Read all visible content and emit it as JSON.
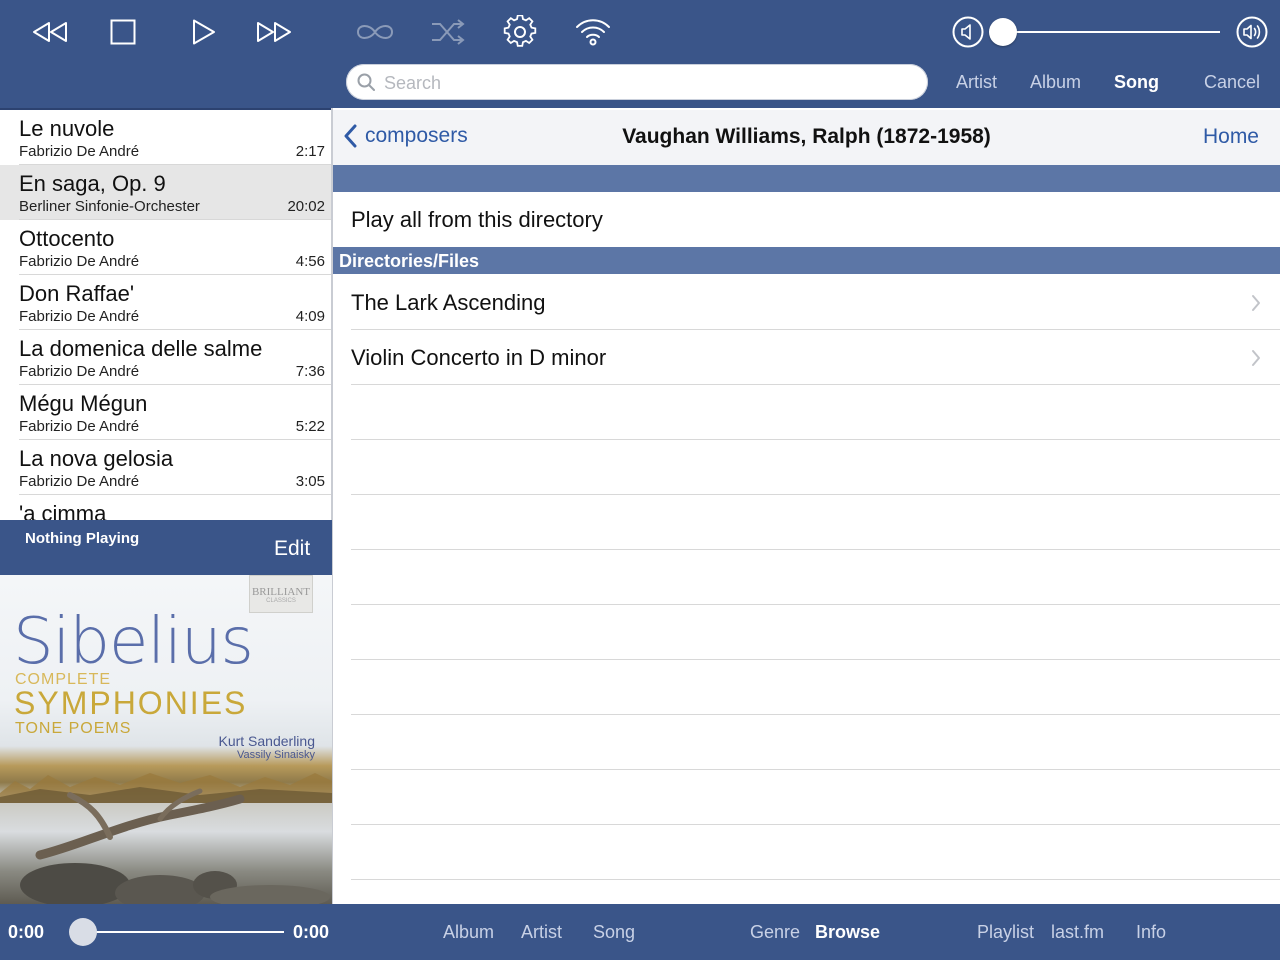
{
  "toolbar": {
    "icons": [
      "rewind-icon",
      "stop-icon",
      "play-icon",
      "fast-forward-icon",
      "repeat-icon",
      "shuffle-icon",
      "gear-icon",
      "wifi-icon",
      "volume-low-icon",
      "volume-high-icon"
    ],
    "volume_level": 0
  },
  "search": {
    "placeholder": "Search",
    "scopes": [
      "Artist",
      "Album",
      "Song"
    ],
    "active_scope": "Song",
    "cancel_label": "Cancel"
  },
  "playlist": [
    {
      "title": "Le nuvole",
      "artist": "Fabrizio De André",
      "duration": "2:17"
    },
    {
      "title": "En saga, Op. 9",
      "artist": "Berliner Sinfonie-Orchester",
      "duration": "20:02",
      "selected": true
    },
    {
      "title": "Ottocento",
      "artist": "Fabrizio De André",
      "duration": "4:56"
    },
    {
      "title": "Don Raffae'",
      "artist": "Fabrizio De André",
      "duration": "4:09"
    },
    {
      "title": "La domenica delle salme",
      "artist": "Fabrizio De André",
      "duration": "7:36"
    },
    {
      "title": "Mégu Mégun",
      "artist": "Fabrizio De André",
      "duration": "5:22"
    },
    {
      "title": "La nova gelosia",
      "artist": "Fabrizio De André",
      "duration": "3:05"
    },
    {
      "title": "'a cimma",
      "artist": "",
      "duration": ""
    }
  ],
  "now_playing": {
    "title": "Nothing Playing",
    "edit_label": "Edit"
  },
  "album_art": {
    "logo": "BRILLIANT",
    "logo_sub": "CLASSICS",
    "line_sibelius": "Sibelius",
    "line_complete": "COMPLETE",
    "line_symphonies": "SYMPHONIES",
    "line_tone_poems": "TONE POEMS",
    "conductor_1": "Kurt Sanderling",
    "conductor_2": "Vassily Sinaisky"
  },
  "browser": {
    "back_label": "composers",
    "title": "Vaughan Williams, Ralph (1872-1958)",
    "home_label": "Home",
    "play_all_label": "Play all from this directory",
    "section_header": "Directories/Files",
    "items": [
      "The Lark Ascending",
      "Violin Concerto in D minor"
    ]
  },
  "bottom": {
    "time_current": "0:00",
    "time_total": "0:00",
    "position_level": 0,
    "tabs": [
      "Album",
      "Artist",
      "Song",
      "Genre",
      "Browse",
      "Playlist",
      "last.fm",
      "Info"
    ],
    "active_tab": "Browse"
  },
  "colors": {
    "bar_blue": "#3a5589",
    "section_blue": "#5c76a6",
    "link_blue": "#2f5aa6"
  }
}
